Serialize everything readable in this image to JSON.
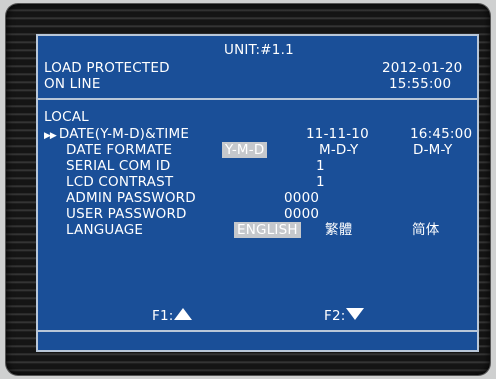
{
  "header": {
    "unit": "UNIT:#1.1",
    "status_line1": "LOAD PROTECTED",
    "status_line2": "ON LINE",
    "date": "2012-01-20",
    "time": "15:55:00"
  },
  "section": "LOCAL",
  "settings": {
    "date_time": {
      "label": "DATE(Y-M-D)&TIME",
      "date": "11-11-10",
      "time": "16:45:00",
      "marker": "▶▶"
    },
    "date_format": {
      "label": "DATE FORMATE",
      "options": [
        "Y-M-D",
        "M-D-Y",
        "D-M-Y"
      ],
      "selected": "Y-M-D"
    },
    "serial_com_id": {
      "label": "SERIAL COM ID",
      "value": "1"
    },
    "lcd_contrast": {
      "label": "LCD CONTRAST",
      "value": "1"
    },
    "admin_password": {
      "label": "ADMIN PASSWORD",
      "value": "0000"
    },
    "user_password": {
      "label": "USER PASSWORD",
      "value": "0000"
    },
    "language": {
      "label": "LANGUAGE",
      "options": [
        "ENGLISH",
        "繁體",
        "简体"
      ],
      "selected": "ENGLISH"
    }
  },
  "footer": {
    "f1": "F1:",
    "f1_icon": "up-triangle-icon",
    "f2": "F2:",
    "f2_icon": "down-triangle-icon"
  },
  "colors": {
    "screen_bg": "#1a4f98",
    "highlight": "#c5c8cc",
    "text": "#ffffff"
  }
}
